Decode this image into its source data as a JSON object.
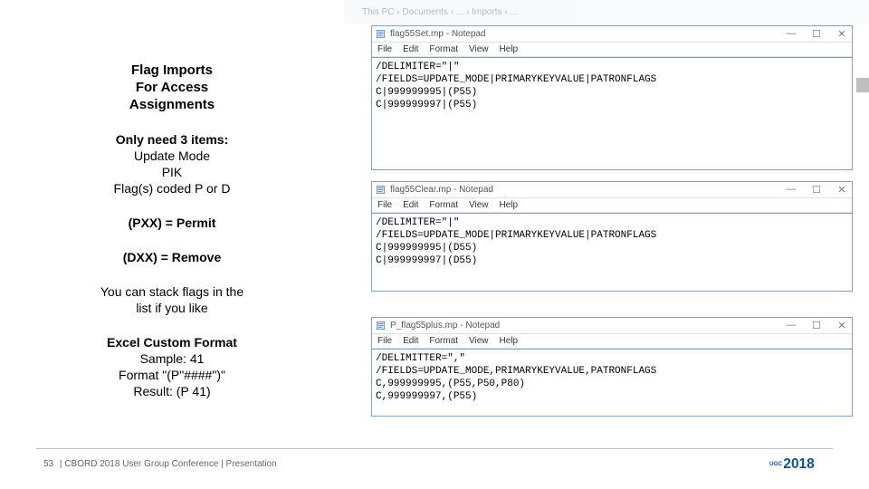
{
  "faded_top": "This PC  ›  Documents  ›  ...  ›  Imports  ›  ...",
  "left": {
    "title_l1": "Flag Imports",
    "title_l2": "For Access",
    "title_l3": "Assignments",
    "need_head": "Only need 3 items:",
    "need_1": "Update Mode",
    "need_2": "PIK",
    "need_3": "Flag(s) coded P or D",
    "permit": "(PXX) = Permit",
    "remove": "(DXX) = Remove",
    "stack_l1": "You can stack flags in the",
    "stack_l2": "list if you like",
    "excel_head": "Excel Custom Format",
    "excel_1": "Sample: 41",
    "excel_2": "Format  \"(P\"####\")\"",
    "excel_3": "Result: (P 41)"
  },
  "notepad_menu": [
    "File",
    "Edit",
    "Format",
    "View",
    "Help"
  ],
  "win_min": "—",
  "win_max": "☐",
  "win_close": "✕",
  "np1": {
    "title": "flag55Set.mp - Notepad",
    "body": "/DELIMITER=\"|\"\n/FIELDS=UPDATE_MODE|PRIMARYKEYVALUE|PATRONFLAGS\nC|999999995|(P55)\nC|999999997|(P55)"
  },
  "np2": {
    "title": "flag55Clear.mp - Notepad",
    "body": "/DELIMITER=\"|\"\n/FIELDS=UPDATE_MODE|PRIMARYKEYVALUE|PATRONFLAGS\nC|999999995|(D55)\nC|999999997|(D55)"
  },
  "np3": {
    "title": "P_flag55plus.mp - Notepad",
    "body": "/DELIMITTER=\",\"\n/FIELDS=UPDATE_MODE,PRIMARYKEYVALUE,PATRONFLAGS\nC,999999995,(P55,P50,P80)\nC,999999997,(P55)"
  },
  "footer": {
    "page": "53",
    "sep": " |  ",
    "text": "CBORD 2018 User Group Conference | Presentation"
  },
  "logo_text": "2018",
  "logo_prefix": "UGC"
}
